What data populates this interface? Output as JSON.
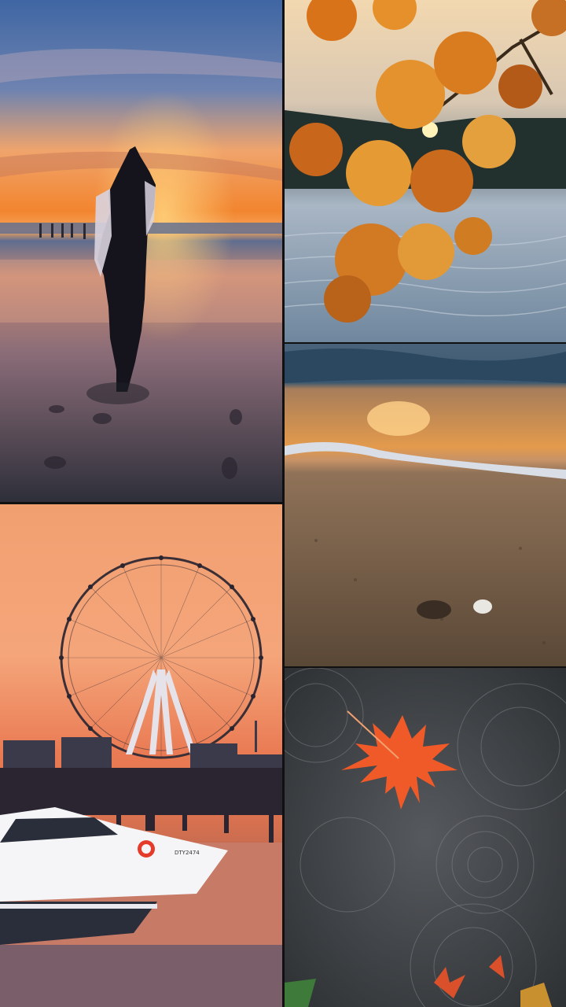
{
  "collage": {
    "tiles": [
      {
        "subject": "beach-sunset-silhouette",
        "palette": [
          "#4a6fa5",
          "#f2a36b",
          "#f07f2c",
          "#3c3a45"
        ]
      },
      {
        "subject": "autumn-maple-over-lake",
        "palette": [
          "#f3b03c",
          "#c9681a",
          "#8fa3b8",
          "#1f2a2e"
        ]
      },
      {
        "subject": "shoreline-wave-sunset",
        "palette": [
          "#3d5a73",
          "#f1a14a",
          "#9a7a5a",
          "#5b4a3a"
        ]
      },
      {
        "subject": "ferris-wheel-marina-sunset",
        "palette": [
          "#f6a472",
          "#e9694a",
          "#2b2730",
          "#ffffff"
        ]
      },
      {
        "subject": "red-leaf-in-rain-puddle",
        "palette": [
          "#3d4043",
          "#f15a24",
          "#6e6f73",
          "#2a2d30"
        ]
      }
    ],
    "watermark_text": "",
    "boat_badge": "DTY2474"
  }
}
